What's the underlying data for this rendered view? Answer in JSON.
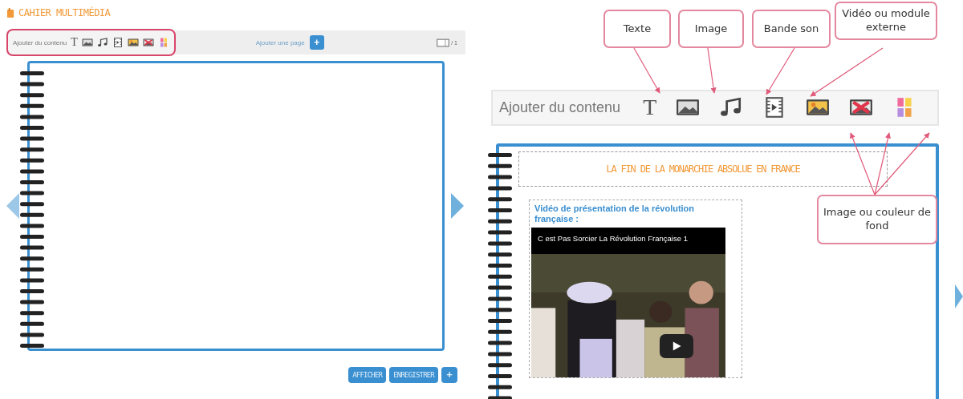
{
  "left_panel": {
    "title": "CAHIER MULTIMÉDIA",
    "toolbar": {
      "label": "Ajouter du contenu",
      "text_icon": "T"
    },
    "add_page": {
      "label": "Ajouter une page",
      "button": "+"
    },
    "page_count": "/ 1",
    "buttons": [
      {
        "label": "AFFICHER",
        "kind": "text"
      },
      {
        "label": "ENREGISTRER",
        "kind": "text"
      },
      {
        "label": "+",
        "kind": "icon"
      }
    ]
  },
  "right_panel": {
    "callouts": [
      {
        "text": "Texte"
      },
      {
        "text": "Image"
      },
      {
        "text": "Bande son"
      },
      {
        "text": "Vidéo ou module externe"
      }
    ],
    "toolbar": {
      "label": "Ajouter du contenu",
      "text_icon": "T"
    },
    "page_title": "LA FIN DE LA MONARCHIE ABSOLUE EN FRANCE",
    "video_block": {
      "title": "Vidéo de présentation de la révolution française :",
      "video_title": "C est Pas Sorcier La Révolution Française 1"
    },
    "bottom_callout": "Image ou couleur de fond"
  }
}
